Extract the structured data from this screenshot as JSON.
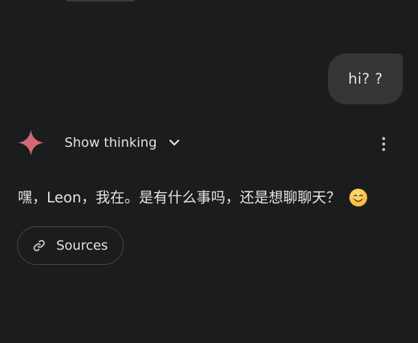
{
  "user_message": {
    "text": "hi? ?"
  },
  "assistant": {
    "thinking_label": "Show thinking",
    "response_text": "嘿，Leon，我在。是有什么事吗，还是想聊聊天？",
    "sources_label": "Sources"
  },
  "icons": {
    "sparkle": "gemini-sparkle-icon",
    "chevron": "chevron-down-icon",
    "more": "more-vert-icon",
    "link": "link-icon",
    "emoji": "smiling-face-emoji"
  },
  "colors": {
    "background": "#1b1c1e",
    "user_bubble": "#333537",
    "sparkle_accent": "#d96570",
    "text": "#e3e3e3"
  }
}
